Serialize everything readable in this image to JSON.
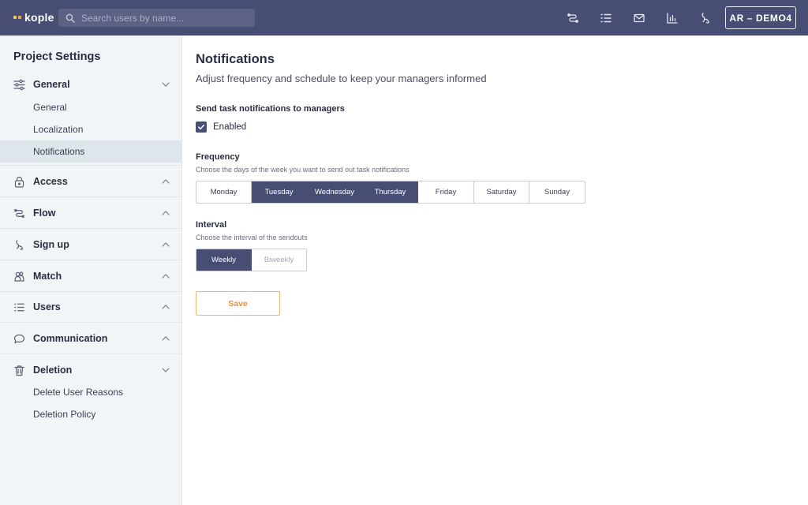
{
  "app": {
    "logo_text": "kople"
  },
  "search": {
    "placeholder": "Search users by name..."
  },
  "topbar": {
    "icons": [
      "flow-icon",
      "list-icon",
      "mail-icon",
      "chart-icon",
      "signup-icon"
    ],
    "account_label": "AR – DEMO4"
  },
  "sidebar": {
    "title": "Project Settings",
    "sections": [
      {
        "label": "General",
        "icon": "sliders-icon",
        "expanded": true,
        "items": [
          "General",
          "Localization",
          "Notifications"
        ]
      },
      {
        "label": "Access",
        "icon": "lock-icon",
        "expanded": false
      },
      {
        "label": "Flow",
        "icon": "flow-icon",
        "expanded": false
      },
      {
        "label": "Sign up",
        "icon": "signup-icon",
        "expanded": false
      },
      {
        "label": "Match",
        "icon": "match-icon",
        "expanded": false
      },
      {
        "label": "Users",
        "icon": "list-icon",
        "expanded": false
      },
      {
        "label": "Communication",
        "icon": "chat-icon",
        "expanded": false
      },
      {
        "label": "Deletion",
        "icon": "trash-icon",
        "expanded": true,
        "items": [
          "Delete User Reasons",
          "Deletion Policy"
        ]
      }
    ],
    "active_item": "Notifications"
  },
  "main": {
    "title": "Notifications",
    "subtitle": "Adjust frequency and schedule to keep your managers informed",
    "send_label": "Send task notifications to managers",
    "enabled_label": "Enabled",
    "enabled": true,
    "frequency": {
      "label": "Frequency",
      "hint": "Choose the days of the week you want to send out task notifications",
      "days": [
        "Monday",
        "Tuesday",
        "Wednesday",
        "Thursday",
        "Friday",
        "Saturday",
        "Sunday"
      ],
      "selected": [
        "Tuesday",
        "Wednesday",
        "Thursday"
      ]
    },
    "interval": {
      "label": "Interval",
      "hint": "Choose the interval of the sendouts",
      "options": [
        "Weekly",
        "Biweekly"
      ],
      "selected": "Weekly"
    },
    "save_label": "Save"
  },
  "colors": {
    "topbar": "#484e73",
    "accent": "#f3b46e",
    "sidebar_bg": "#f1f5f8",
    "active_bg": "#dde6ea"
  }
}
